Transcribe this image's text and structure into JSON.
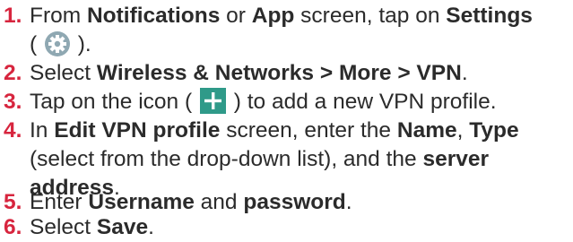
{
  "colors": {
    "number": "#d7253e",
    "text": "#2b2b2b",
    "gear_bg": "#8fa8b2",
    "plus_bg": "#2f9a89"
  },
  "steps": [
    {
      "num": "1.",
      "t1": "From ",
      "b1": "Notifications",
      "t2": " or ",
      "b2": "App",
      "t3": " screen, tap on ",
      "b3": "Settings",
      "l2a": "( ",
      "l2b": " )."
    },
    {
      "num": "2.",
      "t1": "Select ",
      "b1": "Wireless & Networks > More > VPN",
      "t2": "."
    },
    {
      "num": "3.",
      "t1": "Tap on the icon ( ",
      "t2": " ) to add a new VPN profile."
    },
    {
      "num": "4.",
      "t1": "In ",
      "b1": "Edit VPN profile",
      "t2": " screen, enter the ",
      "b2": "Name",
      "t3": ", ",
      "b3": "Type",
      "l2a": "(select from the drop-down list), and the ",
      "l2b": "server",
      "l3a": "address",
      "l3b": "."
    },
    {
      "num": "5.",
      "t1": "Enter ",
      "b1": "Username",
      "t2": " and ",
      "b2": "password",
      "t3": "."
    },
    {
      "num": "6.",
      "t1": "Select ",
      "b1": "Save",
      "t2": "."
    }
  ],
  "icons": {
    "settings": "gear-icon",
    "add": "plus-icon"
  }
}
